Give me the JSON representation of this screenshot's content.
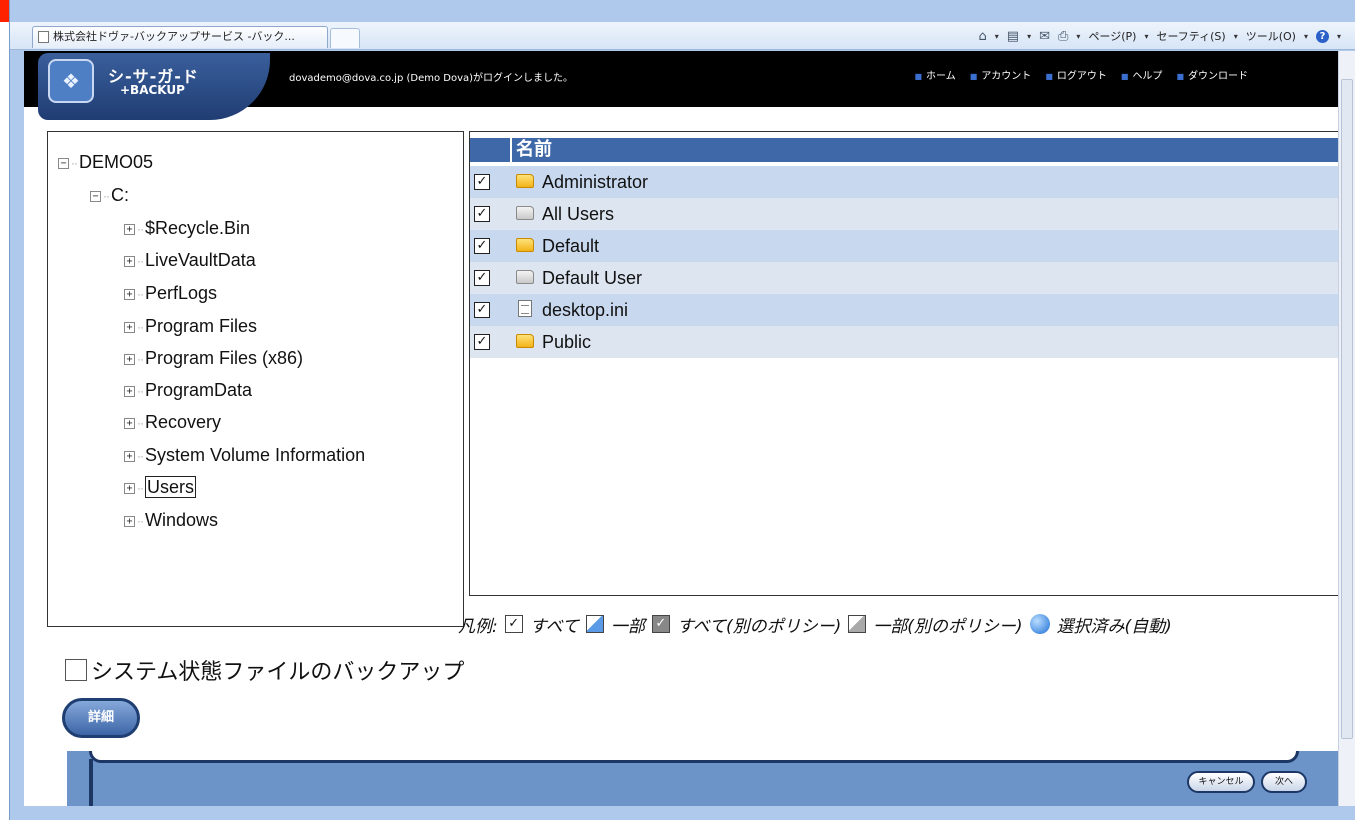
{
  "browser": {
    "tab_title": "株式会社ドヴァ-バックアップサービス -バック...",
    "commands": {
      "page": "ページ(P)",
      "safety": "セーフティ(S)",
      "tools": "ツール(O)"
    }
  },
  "header": {
    "logo_title": "シ-サ-ガ-ド",
    "logo_sub": "+BACKUP",
    "login_text": "dovademo@dova.co.jp (Demo Dova)がログインしました。",
    "nav": [
      "ホーム",
      "アカウント",
      "ログアウト",
      "ヘルプ",
      "ダウンロード"
    ]
  },
  "tree": {
    "root": "DEMO05",
    "drive": "C:",
    "folders": [
      "$Recycle.Bin",
      "LiveVaultData",
      "PerfLogs",
      "Program Files",
      "Program Files (x86)",
      "ProgramData",
      "Recovery",
      "System Volume Information",
      "Users",
      "Windows"
    ],
    "selected": "Users"
  },
  "file_list": {
    "column_name": "名前",
    "rows": [
      {
        "name": "Administrator",
        "icon": "folder-icon",
        "checked": true
      },
      {
        "name": "All Users",
        "icon": "gray-folder-icon",
        "checked": true
      },
      {
        "name": "Default",
        "icon": "folder-icon",
        "checked": true
      },
      {
        "name": "Default User",
        "icon": "gray-folder-icon",
        "checked": true
      },
      {
        "name": "desktop.ini",
        "icon": "file-icon",
        "checked": true
      },
      {
        "name": "Public",
        "icon": "folder-icon",
        "checked": true
      }
    ]
  },
  "legend": {
    "label": "凡例:",
    "all": "すべて",
    "partial": "一部",
    "all_other_policy": "すべて(別のポリシー)",
    "partial_other_policy": "一部(別のポリシー)",
    "auto_selected": "選択済み(自動)"
  },
  "bottom": {
    "system_state_label": "システム状態ファイルのバックアップ",
    "system_state_checked": false,
    "details_button": "詳細",
    "cancel_button": "キャンセル",
    "next_button": "次へ"
  },
  "colors": {
    "header_bg": "#000000",
    "list_header_bg": "#3f68a8",
    "row_bg": "#dde5f0",
    "row_alt_bg": "#c8d8ef",
    "footer_bg": "#6c94c9"
  }
}
